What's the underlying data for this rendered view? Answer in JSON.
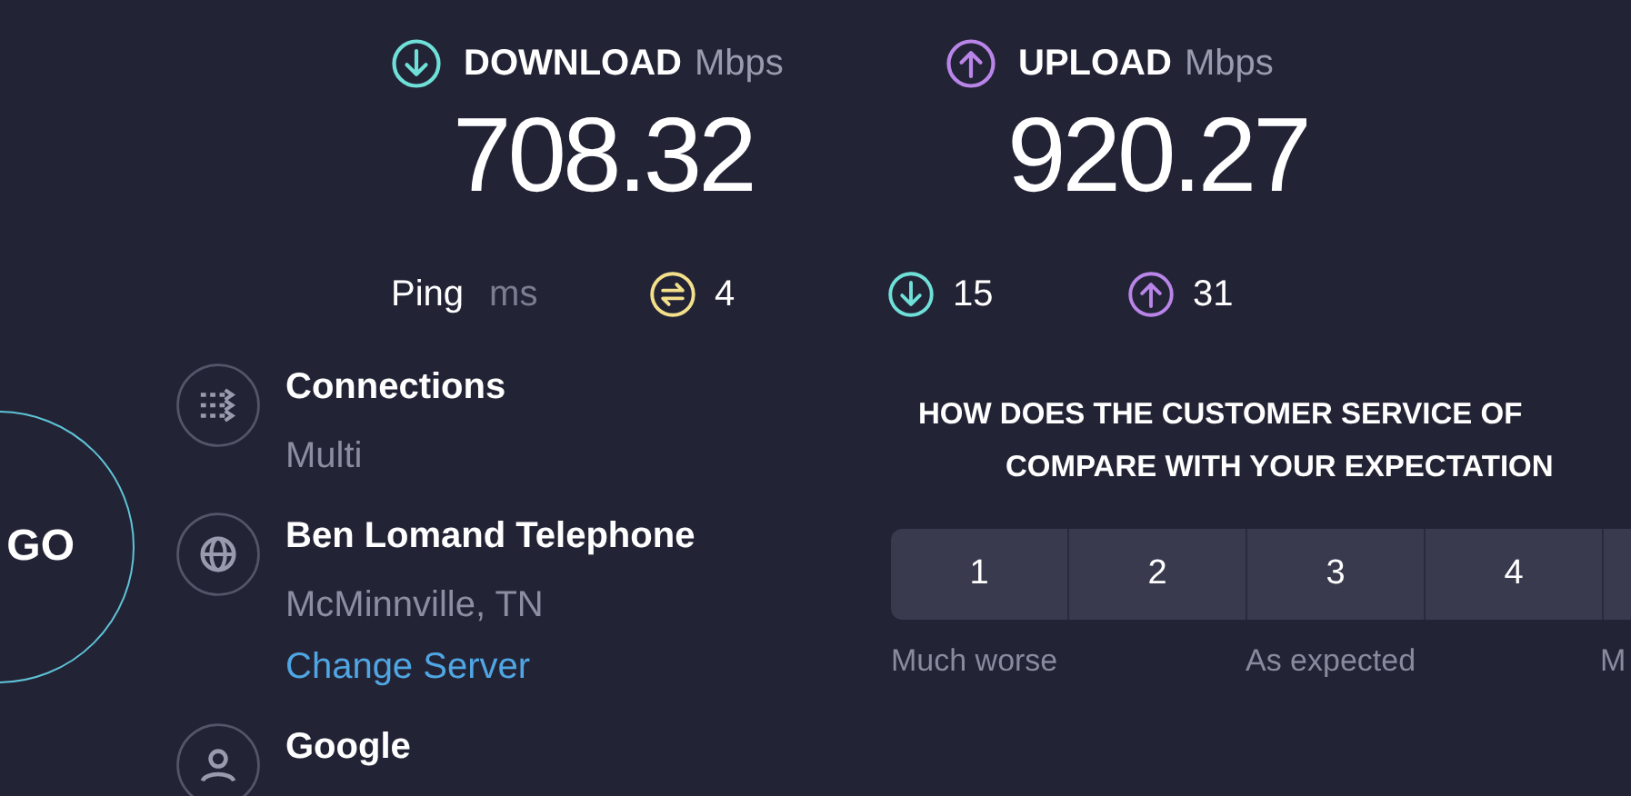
{
  "go_button": {
    "label": "GO"
  },
  "results": [
    {
      "kind": "download",
      "label": "DOWNLOAD",
      "unit": "Mbps",
      "value": "708.32"
    },
    {
      "kind": "upload",
      "label": "UPLOAD",
      "unit": "Mbps",
      "value": "920.27"
    }
  ],
  "ping": {
    "label": "Ping",
    "unit": "ms",
    "items": [
      {
        "kind": "ping",
        "value": "4"
      },
      {
        "kind": "download",
        "value": "15"
      },
      {
        "kind": "upload",
        "value": "31"
      }
    ]
  },
  "info": [
    {
      "kind": "connections",
      "title": "Connections",
      "subtitle": "Multi"
    },
    {
      "kind": "server",
      "title": "Ben Lomand Telephone",
      "subtitle": "McMinnville, TN",
      "link": "Change Server"
    },
    {
      "kind": "provider",
      "title": "Google"
    }
  ],
  "survey": {
    "question_lines": [
      "HOW DOES THE CUSTOMER SERVICE OF",
      "COMPARE WITH YOUR EXPECTATION"
    ],
    "options": [
      {
        "kind": "full",
        "label": "1"
      },
      {
        "kind": "full",
        "label": "2"
      },
      {
        "kind": "full",
        "label": "3"
      },
      {
        "kind": "full",
        "label": "4"
      },
      {
        "kind": "cut"
      }
    ],
    "scale_labels": [
      "Much worse",
      "As expected",
      "M"
    ]
  }
}
